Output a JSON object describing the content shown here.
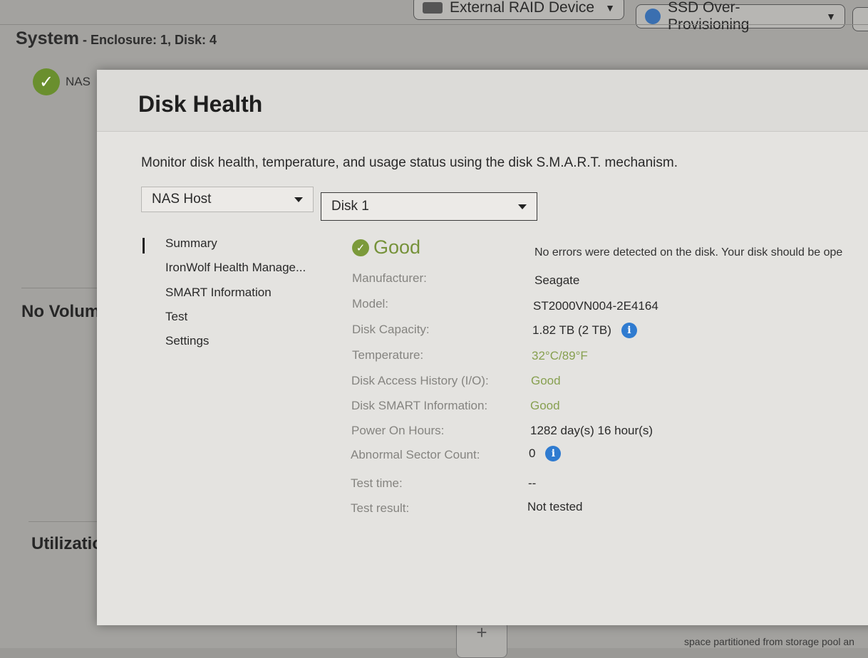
{
  "toolbar": {
    "external_raid": "External RAID Device",
    "ssd_over_provisioning": "SSD Over-Provisioning"
  },
  "system": {
    "title": "System",
    "subtitle": " - Enclosure: 1, Disk: 4",
    "nas_label": "NAS"
  },
  "background": {
    "no_volume_heading": "No Volum",
    "utilization_heading": "Utilizatio",
    "no_volume_link": "No Volume",
    "bottom_note": "space partitioned from storage pool an"
  },
  "modal": {
    "title": "Disk Health",
    "description": "Monitor disk health, temperature, and usage status using the disk S.M.A.R.T. mechanism.",
    "host_select": "NAS Host",
    "disk_select": "Disk 1",
    "nav": [
      "Summary",
      "IronWolf Health Manage...",
      "SMART Information",
      "Test",
      "Settings"
    ],
    "status": "Good",
    "status_message": "No errors were detected on the disk. Your disk should be ope",
    "details": {
      "manufacturer_label": "Manufacturer:",
      "manufacturer": "Seagate",
      "model_label": "Model:",
      "model": "ST2000VN004-2E4164",
      "capacity_label": "Disk Capacity:",
      "capacity": "1.82 TB (2 TB)",
      "temperature_label": "Temperature:",
      "temperature": "32°C/89°F",
      "access_label": "Disk Access History (I/O):",
      "access": "Good",
      "smart_label": "Disk SMART Information:",
      "smart": "Good",
      "power_label": "Power On Hours:",
      "power": "1282 day(s) 16 hour(s)",
      "sector_label": "Abnormal Sector Count:",
      "sector": "0",
      "test_time_label": "Test time:",
      "test_time": "--",
      "test_result_label": "Test result:",
      "test_result": "Not tested"
    }
  },
  "colors": {
    "good_green": "#76923a",
    "info_blue": "#2f7bd0",
    "check_green": "#6a8f2e"
  },
  "icons": [
    "check-circle-icon",
    "info-icon",
    "dropdown-arrow-icon",
    "add-icon"
  ]
}
